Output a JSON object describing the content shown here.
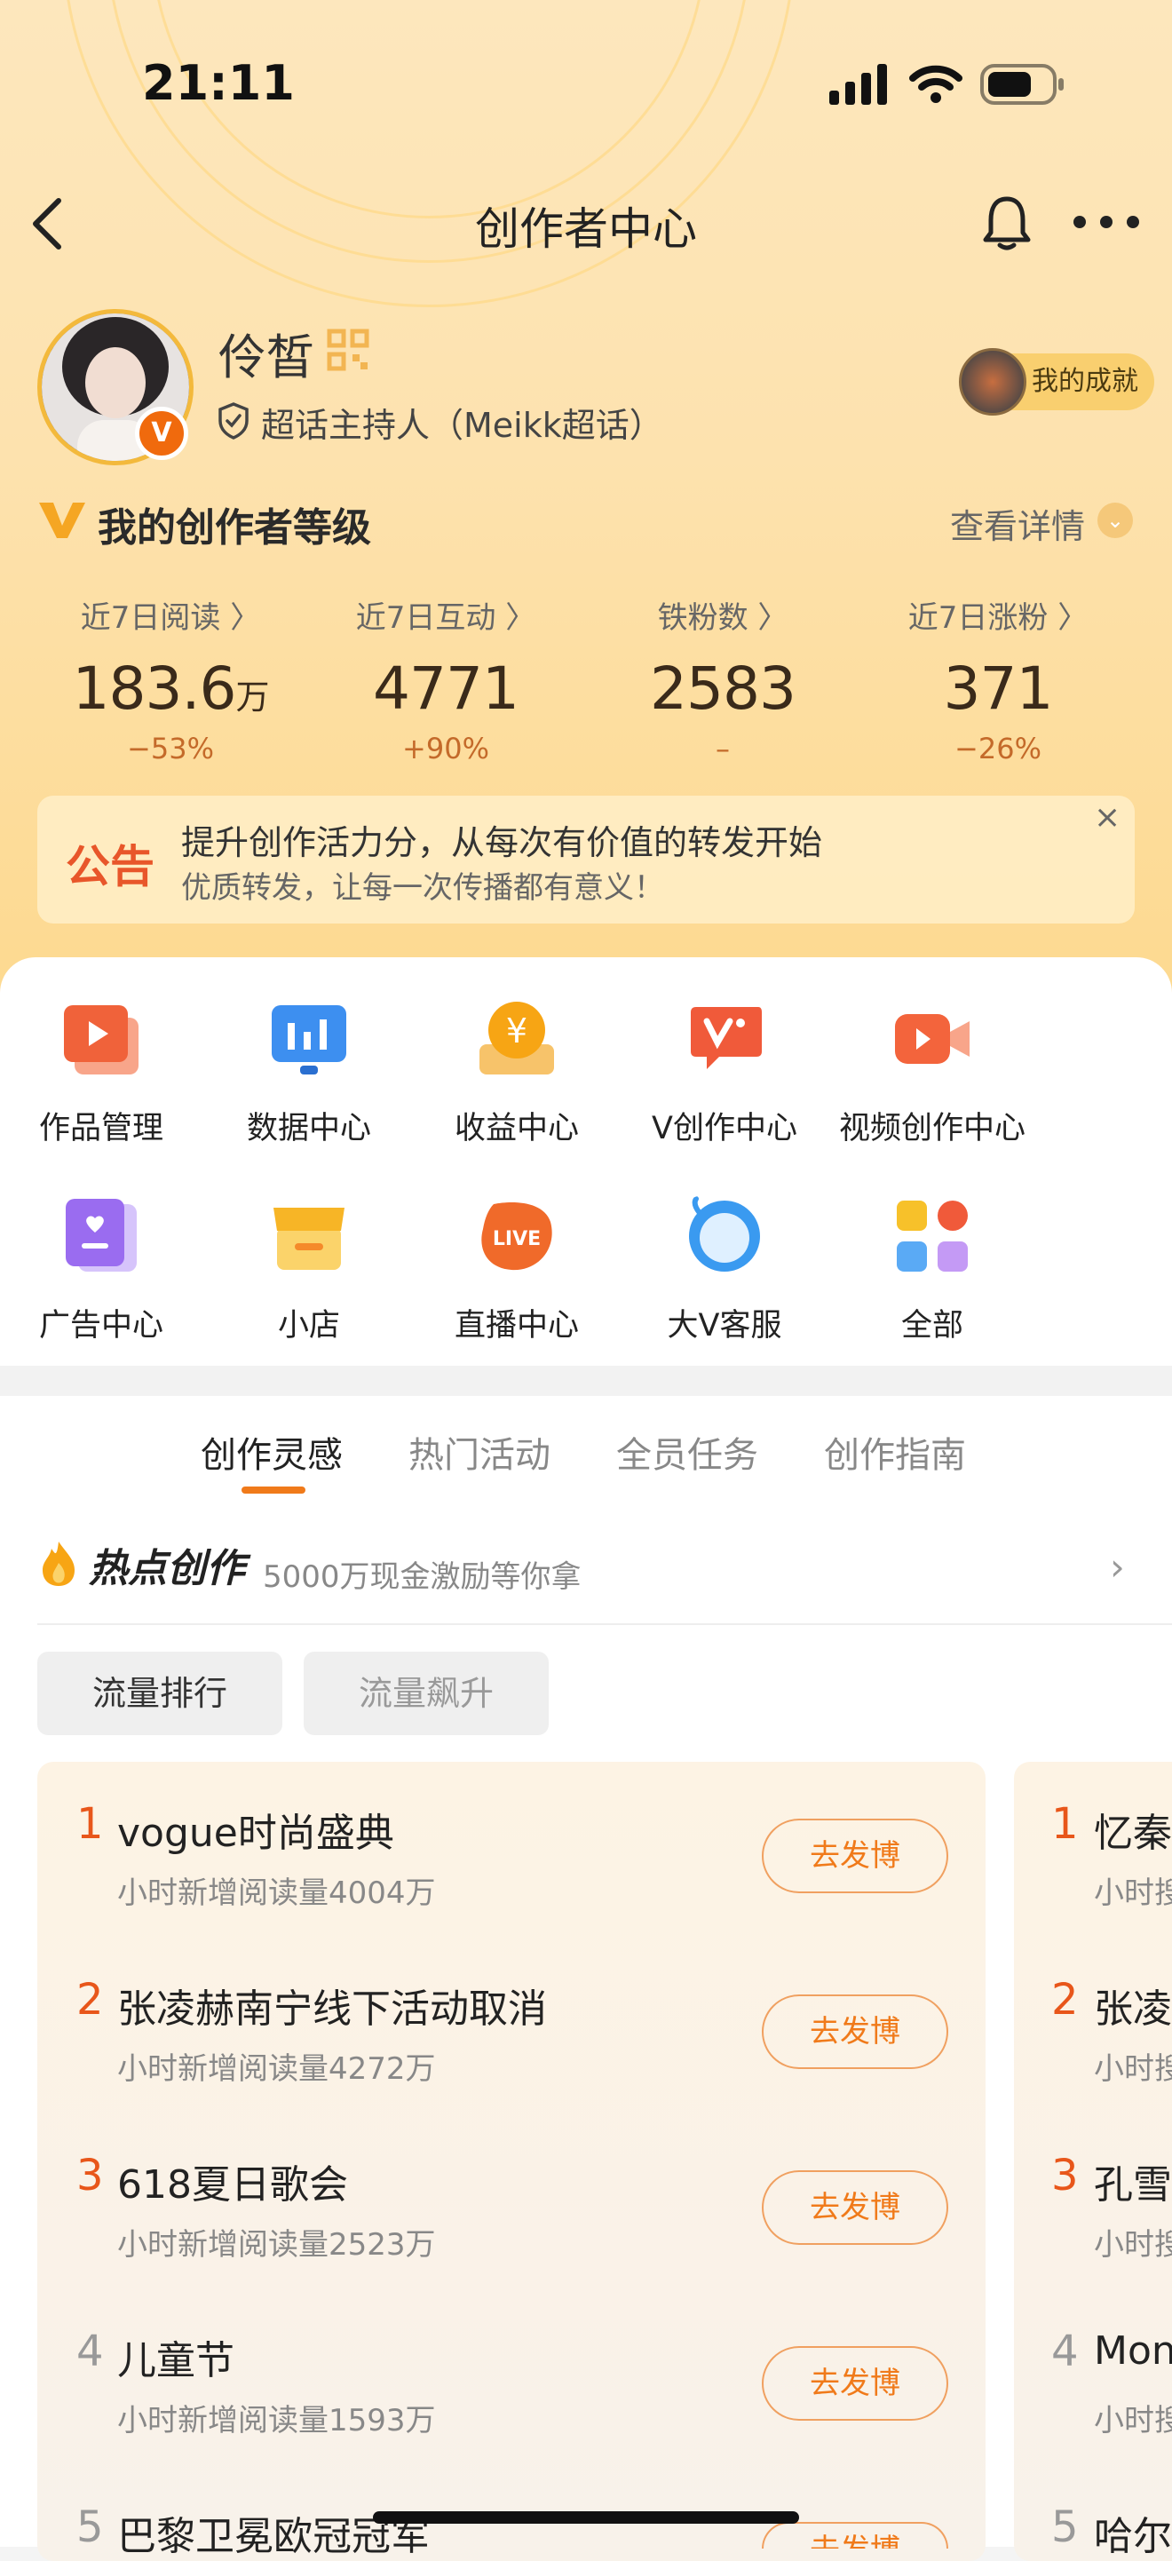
{
  "status": {
    "time": "21:11"
  },
  "header": {
    "title": "创作者中心"
  },
  "profile": {
    "name": "伶皙",
    "role": "超话主持人（Meikk超话）",
    "badge": "V",
    "achievement_label": "我的成就"
  },
  "level": {
    "title": "我的创作者等级",
    "more": "查看详情"
  },
  "stats": [
    {
      "label": "近7日阅读 〉",
      "value": "183.6",
      "unit": "万",
      "change": "−53%"
    },
    {
      "label": "近7日互动 〉",
      "value": "4771",
      "unit": "",
      "change": "+90%"
    },
    {
      "label": "铁粉数 〉",
      "value": "2583",
      "unit": "",
      "change": "–"
    },
    {
      "label": "近7日涨粉 〉",
      "value": "371",
      "unit": "",
      "change": "−26%"
    }
  ],
  "notice": {
    "tag": "公告",
    "line1": "提升创作活力分，从每次有价值的转发开始",
    "line2": "优质转发，让每一次传播都有意义！",
    "close": "×"
  },
  "tools": [
    {
      "label": "作品管理",
      "icon": "works-icon",
      "color": "#f0623a"
    },
    {
      "label": "数据中心",
      "icon": "data-icon",
      "color": "#3d8ff0"
    },
    {
      "label": "收益中心",
      "icon": "income-icon",
      "color": "#f7a514"
    },
    {
      "label": "V创作中心",
      "icon": "v-create-icon",
      "color": "#f05a3a"
    },
    {
      "label": "视频创作中心",
      "icon": "video-icon",
      "color": "#f3643c"
    },
    {
      "label": "广告中心",
      "icon": "ad-icon",
      "color": "#9a6cf0"
    },
    {
      "label": "小店",
      "icon": "shop-icon",
      "color": "#f7b526"
    },
    {
      "label": "直播中心",
      "icon": "live-icon",
      "color": "#f06a2a"
    },
    {
      "label": "大V客服",
      "icon": "service-icon",
      "color": "#3a9af0"
    },
    {
      "label": "全部",
      "icon": "all-icon",
      "color": "#f7b526"
    }
  ],
  "tabs": [
    "创作灵感",
    "热门活动",
    "全员任务",
    "创作指南"
  ],
  "hot": {
    "title": "热点创作",
    "subtitle": "5000万现金激励等你拿"
  },
  "chips": [
    "流量排行",
    "流量飙升"
  ],
  "ranking": [
    {
      "rank": "1",
      "title": "vogue时尚盛典",
      "sub": "小时新增阅读量4004万",
      "btn": "去发博"
    },
    {
      "rank": "2",
      "title": "张凌赫南宁线下活动取消",
      "sub": "小时新增阅读量4272万",
      "btn": "去发博"
    },
    {
      "rank": "3",
      "title": "618夏日歌会",
      "sub": "小时新增阅读量2523万",
      "btn": "去发博"
    },
    {
      "rank": "4",
      "title": "儿童节",
      "sub": "小时新增阅读量1593万",
      "btn": "去发博"
    },
    {
      "rank": "5",
      "title": "巴黎卫冕欧冠冠军",
      "sub": "",
      "btn": "去发博"
    }
  ],
  "ranking2": [
    {
      "rank": "1",
      "title": "忆秦",
      "sub": "小时搜"
    },
    {
      "rank": "2",
      "title": "张凌",
      "sub": "小时搜"
    },
    {
      "rank": "3",
      "title": "孔雪",
      "sub": "小时搜"
    },
    {
      "rank": "4",
      "title": "Mon",
      "sub": "小时搜"
    },
    {
      "rank": "5",
      "title": "哈尔",
      "sub": ""
    }
  ]
}
